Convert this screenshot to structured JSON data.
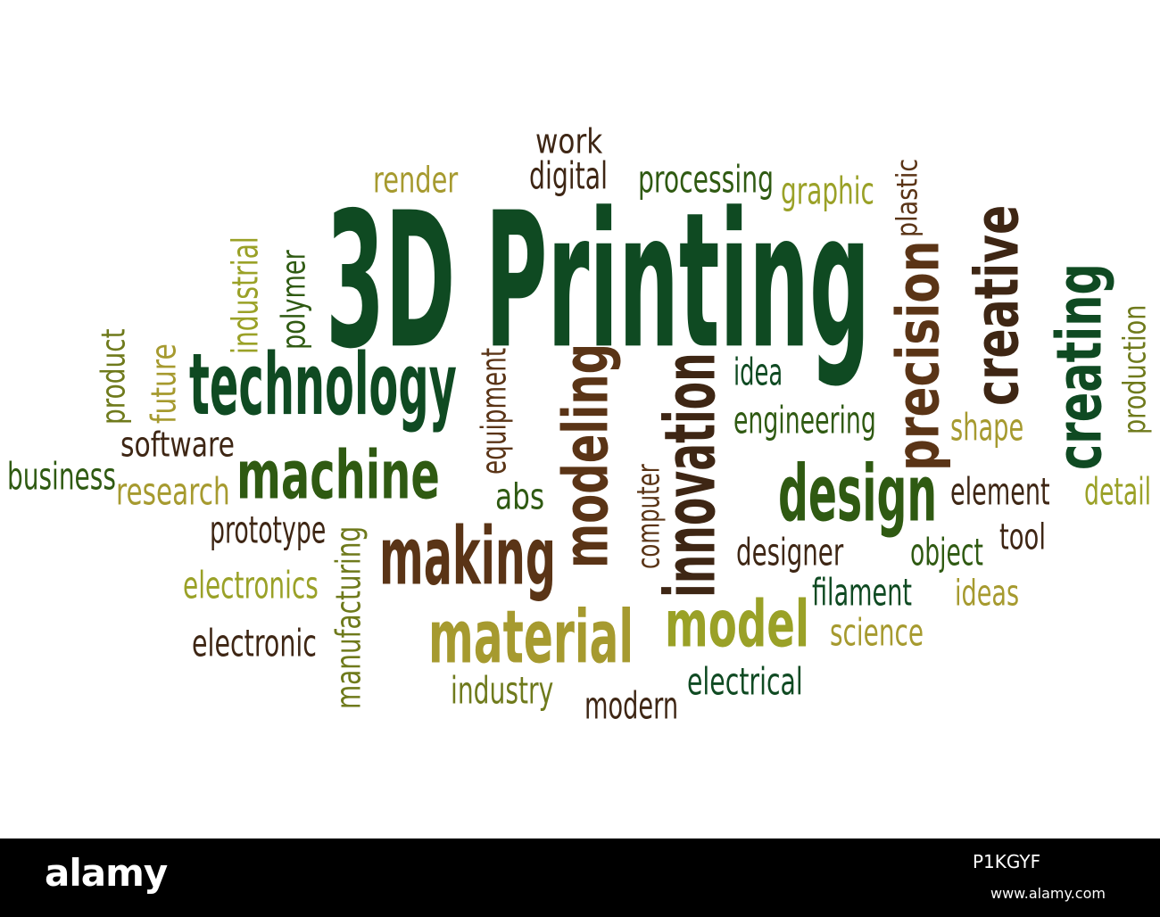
{
  "palette": {
    "dark_green": "#0f4a22",
    "green": "#2f5a12",
    "olive": "#6f7a1c",
    "yellow_olive": "#9aa127",
    "khaki": "#a69a2f",
    "brown": "#5a3416",
    "dark_brown": "#3e2614"
  },
  "words": [
    {
      "text": "3D Printing",
      "color": "dark_green",
      "rot": 0
    },
    {
      "text": "technology",
      "color": "dark_green",
      "rot": 0
    },
    {
      "text": "machine",
      "color": "green",
      "rot": 0
    },
    {
      "text": "making",
      "color": "brown",
      "rot": 0
    },
    {
      "text": "material",
      "color": "khaki",
      "rot": 0
    },
    {
      "text": "model",
      "color": "yellow_olive",
      "rot": 0
    },
    {
      "text": "design",
      "color": "green",
      "rot": 0
    },
    {
      "text": "modeling",
      "color": "brown",
      "rot": -90
    },
    {
      "text": "innovation",
      "color": "dark_brown",
      "rot": -90
    },
    {
      "text": "precision",
      "color": "brown",
      "rot": -90
    },
    {
      "text": "creative",
      "color": "dark_brown",
      "rot": -90
    },
    {
      "text": "creating",
      "color": "dark_green",
      "rot": -90
    },
    {
      "text": "work",
      "color": "dark_brown",
      "rot": 0
    },
    {
      "text": "digital",
      "color": "dark_brown",
      "rot": 0
    },
    {
      "text": "render",
      "color": "khaki",
      "rot": 0
    },
    {
      "text": "processing",
      "color": "green",
      "rot": 0
    },
    {
      "text": "graphic",
      "color": "yellow_olive",
      "rot": 0
    },
    {
      "text": "plastic",
      "color": "brown",
      "rot": -90
    },
    {
      "text": "industrial",
      "color": "yellow_olive",
      "rot": -90
    },
    {
      "text": "polymer",
      "color": "green",
      "rot": -90
    },
    {
      "text": "product",
      "color": "olive",
      "rot": -90
    },
    {
      "text": "future",
      "color": "khaki",
      "rot": -90
    },
    {
      "text": "software",
      "color": "dark_brown",
      "rot": 0
    },
    {
      "text": "business",
      "color": "green",
      "rot": 0
    },
    {
      "text": "research",
      "color": "khaki",
      "rot": 0
    },
    {
      "text": "prototype",
      "color": "dark_brown",
      "rot": 0
    },
    {
      "text": "electronics",
      "color": "yellow_olive",
      "rot": 0
    },
    {
      "text": "electronic",
      "color": "dark_brown",
      "rot": 0
    },
    {
      "text": "manufacturing",
      "color": "olive",
      "rot": -90
    },
    {
      "text": "equipment",
      "color": "brown",
      "rot": -90
    },
    {
      "text": "abs",
      "color": "green",
      "rot": 0
    },
    {
      "text": "idea",
      "color": "dark_green",
      "rot": 0
    },
    {
      "text": "engineering",
      "color": "green",
      "rot": 0
    },
    {
      "text": "computer",
      "color": "brown",
      "rot": -90
    },
    {
      "text": "shape",
      "color": "khaki",
      "rot": 0
    },
    {
      "text": "production",
      "color": "olive",
      "rot": -90
    },
    {
      "text": "element",
      "color": "dark_brown",
      "rot": 0
    },
    {
      "text": "detail",
      "color": "yellow_olive",
      "rot": 0
    },
    {
      "text": "designer",
      "color": "dark_brown",
      "rot": 0
    },
    {
      "text": "object",
      "color": "green",
      "rot": 0
    },
    {
      "text": "tool",
      "color": "dark_brown",
      "rot": 0
    },
    {
      "text": "filament",
      "color": "dark_green",
      "rot": 0
    },
    {
      "text": "ideas",
      "color": "khaki",
      "rot": 0
    },
    {
      "text": "science",
      "color": "khaki",
      "rot": 0
    },
    {
      "text": "industry",
      "color": "olive",
      "rot": 0
    },
    {
      "text": "modern",
      "color": "dark_brown",
      "rot": 0
    },
    {
      "text": "electrical",
      "color": "dark_green",
      "rot": 0
    }
  ],
  "footer": {
    "logo": "alamy",
    "image_id": "P1KGYF",
    "site": "www.alamy.com"
  }
}
